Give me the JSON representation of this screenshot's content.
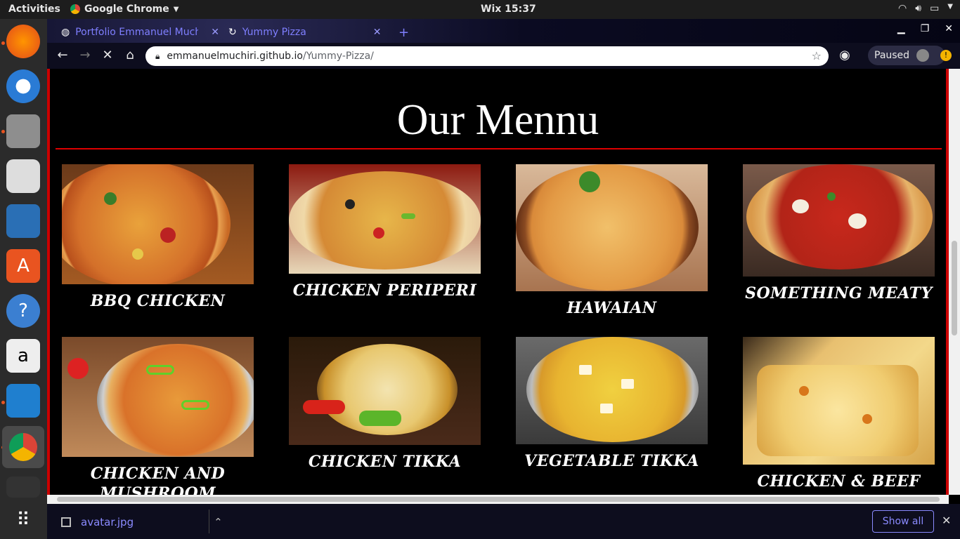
{
  "topbar": {
    "activities": "Activities",
    "app_name": "Google Chrome",
    "clock": "Wix 15:37"
  },
  "browser": {
    "tabs": [
      {
        "label": "Portfolio Emmanuel Much",
        "active": false
      },
      {
        "label": "Yummy Pizza",
        "active": true
      }
    ],
    "url_host": "emmanuelmuchiri.github.io",
    "url_path": "/Yummy-Pizza/",
    "profile_status": "Paused"
  },
  "page": {
    "heading": "Our Mennu",
    "items": [
      {
        "name": "BBQ CHICKEN"
      },
      {
        "name": "CHICKEN PERIPERI"
      },
      {
        "name": "HAWAIAN"
      },
      {
        "name": "SOMETHING MEATY"
      },
      {
        "name": "CHICKEN AND MUSHROOM"
      },
      {
        "name": "CHICKEN TIKKA"
      },
      {
        "name": "VEGETABLE TIKKA"
      },
      {
        "name": "CHICKEN & BEEF"
      }
    ]
  },
  "downloads": {
    "file": "avatar.jpg",
    "show_all": "Show all"
  },
  "colors": {
    "accent_red": "#cc0000",
    "link_blue": "#8a8aff"
  }
}
